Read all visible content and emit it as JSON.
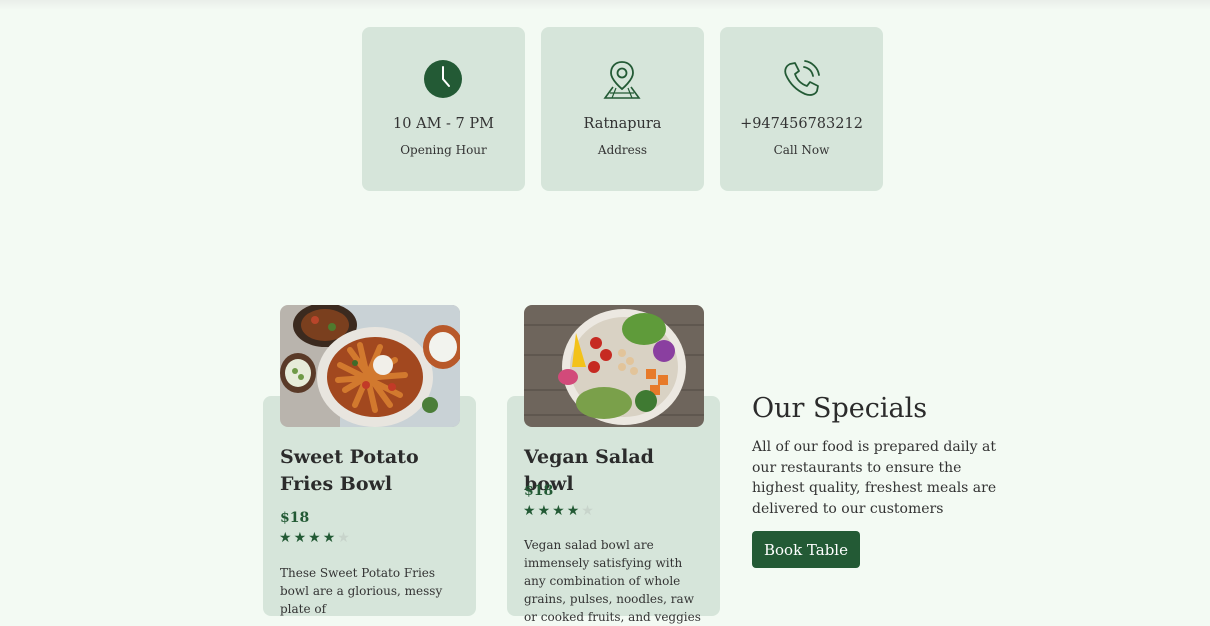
{
  "info": [
    {
      "value": "10 AM - 7 PM",
      "label": "Opening Hour",
      "icon": "clock-icon"
    },
    {
      "value": "Ratnapura",
      "label": "Address",
      "icon": "map-pin-icon"
    },
    {
      "value": "+947456783212",
      "label": "Call Now",
      "icon": "phone-icon"
    }
  ],
  "dishes": [
    {
      "title": "Sweet Potato Fries Bowl",
      "price": "$18",
      "rating": 4,
      "rating_max": 5,
      "description": "These Sweet Potato Fries bowl are a glorious, messy plate of"
    },
    {
      "title": "Vegan Salad bowl",
      "price": "$18",
      "rating": 4,
      "rating_max": 5,
      "description": "Vegan salad bowl are immensely satisfying with any combination of whole grains, pulses, noodles, raw or cooked fruits, and veggies"
    }
  ],
  "specials": {
    "title": "Our Specials",
    "text": "All of our food is prepared daily at our restaurants to ensure the highest quality, freshest meals are delivered to our customers",
    "button": "Book Table"
  },
  "colors": {
    "accent": "#235a35",
    "card": "#d6e5da",
    "background": "#f3faf3"
  }
}
